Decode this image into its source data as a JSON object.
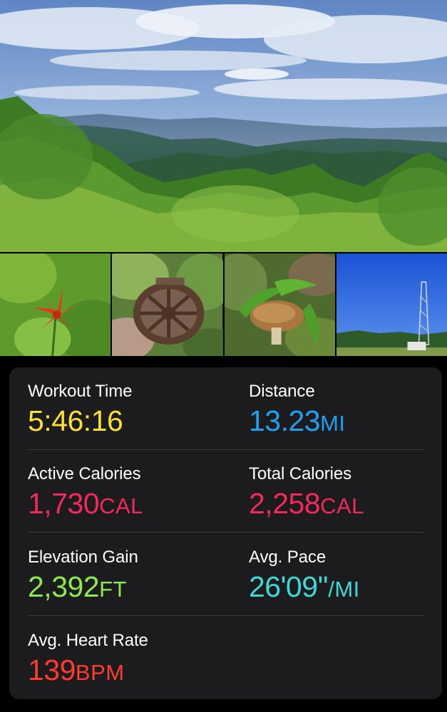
{
  "photos": {
    "main": {
      "subject": "mountain-vista"
    },
    "thumbnails": [
      {
        "subject": "orange-lily"
      },
      {
        "subject": "rusted-wheel"
      },
      {
        "subject": "mushroom"
      },
      {
        "subject": "radio-tower"
      }
    ]
  },
  "colors": {
    "card_bg": "#1c1c1e",
    "workout_time": "#f9e233",
    "distance": "#1ea1f2",
    "calories": "#f2295a",
    "elevation": "#8de94d",
    "pace": "#3fd9d6",
    "heart_rate": "#ff3b30"
  },
  "stats": {
    "workout_time": {
      "label": "Workout Time",
      "value": "5:46:16",
      "unit": ""
    },
    "distance": {
      "label": "Distance",
      "value": "13.23",
      "unit": "MI"
    },
    "active_calories": {
      "label": "Active Calories",
      "value": "1,730",
      "unit": "CAL"
    },
    "total_calories": {
      "label": "Total Calories",
      "value": "2,258",
      "unit": "CAL"
    },
    "elevation_gain": {
      "label": "Elevation Gain",
      "value": "2,392",
      "unit": "FT"
    },
    "avg_pace": {
      "label": "Avg. Pace",
      "value": "26'09''",
      "unit": "/MI"
    },
    "avg_heart_rate": {
      "label": "Avg. Heart Rate",
      "value": "139",
      "unit": "BPM"
    }
  }
}
